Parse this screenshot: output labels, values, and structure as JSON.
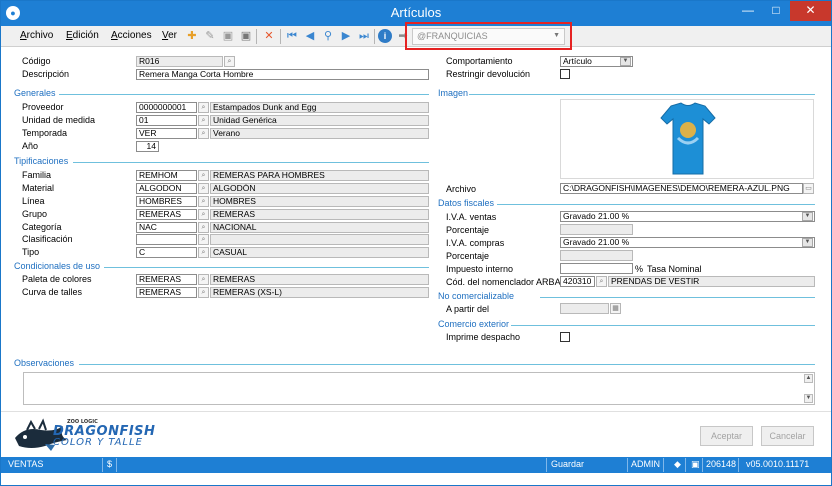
{
  "window": {
    "title": "Artículos"
  },
  "menu": [
    {
      "label": "Archivo",
      "u": "A",
      "rest": "rchivo"
    },
    {
      "label": "Edición",
      "u": "E",
      "rest": "dición"
    },
    {
      "label": "Acciones",
      "u": "A",
      "rest": "cciones"
    },
    {
      "label": "Ver",
      "u": "V",
      "rest": "er"
    }
  ],
  "toolbar": {
    "combo_value": "@FRANQUICIAS"
  },
  "form": {
    "codigo_label": "Código",
    "codigo": "R016",
    "descripcion_label": "Descripción",
    "descripcion": "Remera Manga Corta Hombre",
    "comportamiento_label": "Comportamiento",
    "comportamiento": "Artículo",
    "restringir_label": "Restringir devolución"
  },
  "generales": {
    "title": "Generales",
    "proveedor_label": "Proveedor",
    "proveedor_code": "0000000001",
    "proveedor_desc": "Estampados Dunk and Egg",
    "unidad_label": "Unidad de medida",
    "unidad_code": "01",
    "unidad_desc": "Unidad Genérica",
    "temporada_label": "Temporada",
    "temporada_code": "VER",
    "temporada_desc": "Verano",
    "anio_label": "Año",
    "anio": "14"
  },
  "tipificaciones": {
    "title": "Tipificaciones",
    "familia_label": "Familia",
    "familia_code": "REMHOM",
    "familia_desc": "REMERAS PARA HOMBRES",
    "material_label": "Material",
    "material_code": "ALGODON",
    "material_desc": "ALGODÓN",
    "linea_label": "Línea",
    "linea_code": "HOMBRES",
    "linea_desc": "HOMBRES",
    "grupo_label": "Grupo",
    "grupo_code": "REMERAS",
    "grupo_desc": "REMERAS",
    "categoria_label": "Categoría",
    "categoria_code": "NAC",
    "categoria_desc": "NACIONAL",
    "clasificacion_label": "Clasificación",
    "clasificacion_code": "",
    "clasificacion_desc": "",
    "tipo_label": "Tipo",
    "tipo_code": "C",
    "tipo_desc": "CASUAL"
  },
  "condicionales": {
    "title": "Condicionales de uso",
    "paleta_label": "Paleta de colores",
    "paleta_code": "REMERAS",
    "paleta_desc": "REMERAS",
    "curva_label": "Curva de talles",
    "curva_code": "REMERAS",
    "curva_desc": "REMERAS (XS-L)"
  },
  "imagen": {
    "title": "Imagen",
    "archivo_label": "Archivo",
    "archivo": "C:\\DRAGONFISH\\IMAGENES\\DEMO\\REMERA-AZUL.PNG",
    "shirt_color": "#1d8fd6"
  },
  "fiscales": {
    "title": "Datos fiscales",
    "iva_ventas_label": "I.V.A. ventas",
    "iva_ventas": "Gravado 21.00 %",
    "porcentaje_label": "Porcentaje",
    "iva_compras_label": "I.V.A. compras",
    "iva_compras": "Gravado 21.00 %",
    "porcentaje2_label": "Porcentaje",
    "impuesto_label": "Impuesto interno",
    "percent_sign": "%",
    "tasa_label": "Tasa Nominal",
    "arba_label": "Cód. del nomenclador ARBA",
    "arba_code": "420310",
    "arba_desc": "PRENDAS DE VESTIR"
  },
  "no_comercializable": {
    "title": "No comercializable",
    "apartir_label": "A partir del"
  },
  "comercio": {
    "title": "Comercio exterior",
    "imprime_label": "Imprime despacho"
  },
  "observaciones": {
    "title": "Observaciones"
  },
  "logo": {
    "brand_small": "ZOO LOGIC",
    "line1": "DRAGONFISH",
    "line2": "COLOR Y TALLE"
  },
  "buttons": {
    "aceptar": "Aceptar",
    "cancelar": "Cancelar"
  },
  "status": {
    "ventas": "VENTAS",
    "dollar": "$",
    "guardar": "Guardar",
    "admin": "ADMIN",
    "num": "206148",
    "version": "v05.0010.11171"
  },
  "colors": {
    "accent": "#1e7fd4",
    "section": "#1e6fc0",
    "highlight": "#e52222"
  }
}
